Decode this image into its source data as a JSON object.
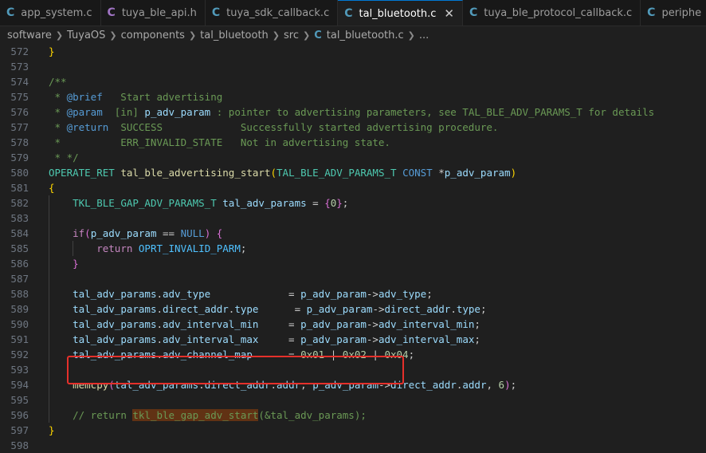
{
  "tabs": [
    {
      "icon": "C",
      "label": "app_system.c",
      "active": false,
      "close": ""
    },
    {
      "icon": "C",
      "label": "tuya_ble_api.h",
      "active": false,
      "close": ""
    },
    {
      "icon": "C",
      "label": "tuya_sdk_callback.c",
      "active": false,
      "close": ""
    },
    {
      "icon": "C",
      "label": "tal_bluetooth.c",
      "active": true,
      "close": "✕"
    },
    {
      "icon": "C",
      "label": "tuya_ble_protocol_callback.c",
      "active": false,
      "close": ""
    },
    {
      "icon": "C",
      "label": "periphe",
      "active": false,
      "close": ""
    }
  ],
  "breadcrumb": [
    "software",
    "TuyaOS",
    "components",
    "tal_bluetooth",
    "src"
  ],
  "breadcrumb_file": {
    "icon": "C",
    "label": "tal_bluetooth.c",
    "tail": "..."
  },
  "colors": {
    "accent": "#0078d4",
    "highlight_box": "#e5302b",
    "c_icon": "#519aba",
    "h_icon": "#a074c4"
  },
  "lines": [
    {
      "n": "572",
      "i": 0,
      "t": [
        [
          "}",
          "br1"
        ]
      ]
    },
    {
      "n": "573",
      "i": 0,
      "t": []
    },
    {
      "n": "574",
      "i": 0,
      "t": [
        [
          "/**",
          "cm"
        ]
      ]
    },
    {
      "n": "575",
      "i": 0,
      "t": [
        [
          " * ",
          "cm"
        ],
        [
          "@brief",
          "tg"
        ],
        [
          "   Start advertising",
          "cm"
        ]
      ]
    },
    {
      "n": "576",
      "i": 0,
      "t": [
        [
          " * ",
          "cm"
        ],
        [
          "@param",
          "tg"
        ],
        [
          "  [in] ",
          "cm"
        ],
        [
          "p_adv_param",
          "pk"
        ],
        [
          " : pointer to advertising parameters, see TAL_BLE_ADV_PARAMS_T for details",
          "cm"
        ]
      ]
    },
    {
      "n": "577",
      "i": 0,
      "t": [
        [
          " * ",
          "cm"
        ],
        [
          "@return",
          "tg"
        ],
        [
          "  SUCCESS             Successfully started advertising procedure.",
          "cm"
        ]
      ]
    },
    {
      "n": "578",
      "i": 0,
      "t": [
        [
          " *          ERR_INVALID_STATE   Not in advertising state.",
          "cm"
        ]
      ]
    },
    {
      "n": "579",
      "i": 0,
      "t": [
        [
          " * */",
          "cm"
        ]
      ]
    },
    {
      "n": "580",
      "i": 0,
      "t": [
        [
          "OPERATE_RET",
          "ty"
        ],
        [
          " ",
          ""
        ],
        [
          "tal_ble_advertising_start",
          "fn"
        ],
        [
          "(",
          "br1"
        ],
        [
          "TAL_BLE_ADV_PARAMS_T",
          "ty"
        ],
        [
          " ",
          ""
        ],
        [
          "CONST",
          "kw"
        ],
        [
          " *",
          ""
        ],
        [
          "p_adv_param",
          "vr"
        ],
        [
          ")",
          "br1"
        ]
      ]
    },
    {
      "n": "581",
      "i": 0,
      "t": [
        [
          "{",
          "br1"
        ]
      ]
    },
    {
      "n": "582",
      "i": 1,
      "t": [
        [
          "    ",
          ""
        ],
        [
          "TKL_BLE_GAP_ADV_PARAMS_T",
          "ty"
        ],
        [
          " ",
          ""
        ],
        [
          "tal_adv_params",
          "vr"
        ],
        [
          " = ",
          ""
        ],
        [
          "{",
          "br2"
        ],
        [
          "0",
          "nm"
        ],
        [
          "}",
          "br2"
        ],
        [
          ";",
          ""
        ]
      ]
    },
    {
      "n": "583",
      "i": 1,
      "t": []
    },
    {
      "n": "584",
      "i": 1,
      "t": [
        [
          "    ",
          ""
        ],
        [
          "if",
          "ck"
        ],
        [
          "(",
          "br2"
        ],
        [
          "p_adv_param",
          "vr"
        ],
        [
          " == ",
          ""
        ],
        [
          "NULL",
          "kw"
        ],
        [
          ")",
          "br2"
        ],
        [
          " ",
          ""
        ],
        [
          "{",
          "br2"
        ]
      ]
    },
    {
      "n": "585",
      "i": 2,
      "t": [
        [
          "        ",
          ""
        ],
        [
          "return",
          "ck"
        ],
        [
          " ",
          ""
        ],
        [
          "OPRT_INVALID_PARM",
          "mc"
        ],
        [
          ";",
          ""
        ]
      ]
    },
    {
      "n": "586",
      "i": 1,
      "t": [
        [
          "    ",
          ""
        ],
        [
          "}",
          "br2"
        ]
      ]
    },
    {
      "n": "587",
      "i": 1,
      "t": []
    },
    {
      "n": "588",
      "i": 1,
      "t": [
        [
          "    ",
          ""
        ],
        [
          "tal_adv_params",
          "vr"
        ],
        [
          ".",
          ""
        ],
        [
          "adv_type",
          "vr"
        ],
        [
          "             = ",
          ""
        ],
        [
          "p_adv_param",
          "vr"
        ],
        [
          "->",
          ""
        ],
        [
          "adv_type",
          "vr"
        ],
        [
          ";",
          ""
        ]
      ]
    },
    {
      "n": "589",
      "i": 1,
      "t": [
        [
          "    ",
          ""
        ],
        [
          "tal_adv_params",
          "vr"
        ],
        [
          ".",
          ""
        ],
        [
          "direct_addr",
          "vr"
        ],
        [
          ".",
          ""
        ],
        [
          "type",
          "vr"
        ],
        [
          "      = ",
          ""
        ],
        [
          "p_adv_param",
          "vr"
        ],
        [
          "->",
          ""
        ],
        [
          "direct_addr",
          "vr"
        ],
        [
          ".",
          ""
        ],
        [
          "type",
          "vr"
        ],
        [
          ";",
          ""
        ]
      ]
    },
    {
      "n": "590",
      "i": 1,
      "t": [
        [
          "    ",
          ""
        ],
        [
          "tal_adv_params",
          "vr"
        ],
        [
          ".",
          ""
        ],
        [
          "adv_interval_min",
          "vr"
        ],
        [
          "     = ",
          ""
        ],
        [
          "p_adv_param",
          "vr"
        ],
        [
          "->",
          ""
        ],
        [
          "adv_interval_min",
          "vr"
        ],
        [
          ";",
          ""
        ]
      ]
    },
    {
      "n": "591",
      "i": 1,
      "t": [
        [
          "    ",
          ""
        ],
        [
          "tal_adv_params",
          "vr"
        ],
        [
          ".",
          ""
        ],
        [
          "adv_interval_max",
          "vr"
        ],
        [
          "     = ",
          ""
        ],
        [
          "p_adv_param",
          "vr"
        ],
        [
          "->",
          ""
        ],
        [
          "adv_interval_max",
          "vr"
        ],
        [
          ";",
          ""
        ]
      ]
    },
    {
      "n": "592",
      "i": 1,
      "t": [
        [
          "    ",
          ""
        ],
        [
          "tal_adv_params",
          "vr"
        ],
        [
          ".",
          ""
        ],
        [
          "adv_channel_map",
          "vr"
        ],
        [
          "      = ",
          ""
        ],
        [
          "0x01",
          "nm"
        ],
        [
          " | ",
          ""
        ],
        [
          "0x02",
          "nm"
        ],
        [
          " | ",
          ""
        ],
        [
          "0x04",
          "nm"
        ],
        [
          ";",
          ""
        ]
      ]
    },
    {
      "n": "593",
      "i": 1,
      "t": []
    },
    {
      "n": "594",
      "i": 1,
      "t": [
        [
          "    ",
          ""
        ],
        [
          "memcpy",
          "fn"
        ],
        [
          "(",
          "br2"
        ],
        [
          "tal_adv_params",
          "vr"
        ],
        [
          ".",
          ""
        ],
        [
          "direct_addr",
          "vr"
        ],
        [
          ".",
          ""
        ],
        [
          "addr",
          "vr"
        ],
        [
          ", ",
          ""
        ],
        [
          "p_adv_param",
          "vr"
        ],
        [
          "->",
          ""
        ],
        [
          "direct_addr",
          "vr"
        ],
        [
          ".",
          ""
        ],
        [
          "addr",
          "vr"
        ],
        [
          ", ",
          ""
        ],
        [
          "6",
          "nm"
        ],
        [
          ")",
          "br2"
        ],
        [
          ";",
          ""
        ]
      ]
    },
    {
      "n": "595",
      "i": 1,
      "t": []
    },
    {
      "n": "596",
      "i": 1,
      "t": [
        [
          "    ",
          ""
        ],
        [
          "// return ",
          "cm"
        ],
        [
          "tkl_ble_gap_adv_start",
          "cm hl"
        ],
        [
          "(&tal_adv_params);",
          "cm"
        ]
      ]
    },
    {
      "n": "597",
      "i": 0,
      "t": [
        [
          "}",
          "br1"
        ]
      ]
    },
    {
      "n": "598",
      "i": 0,
      "t": []
    }
  ]
}
